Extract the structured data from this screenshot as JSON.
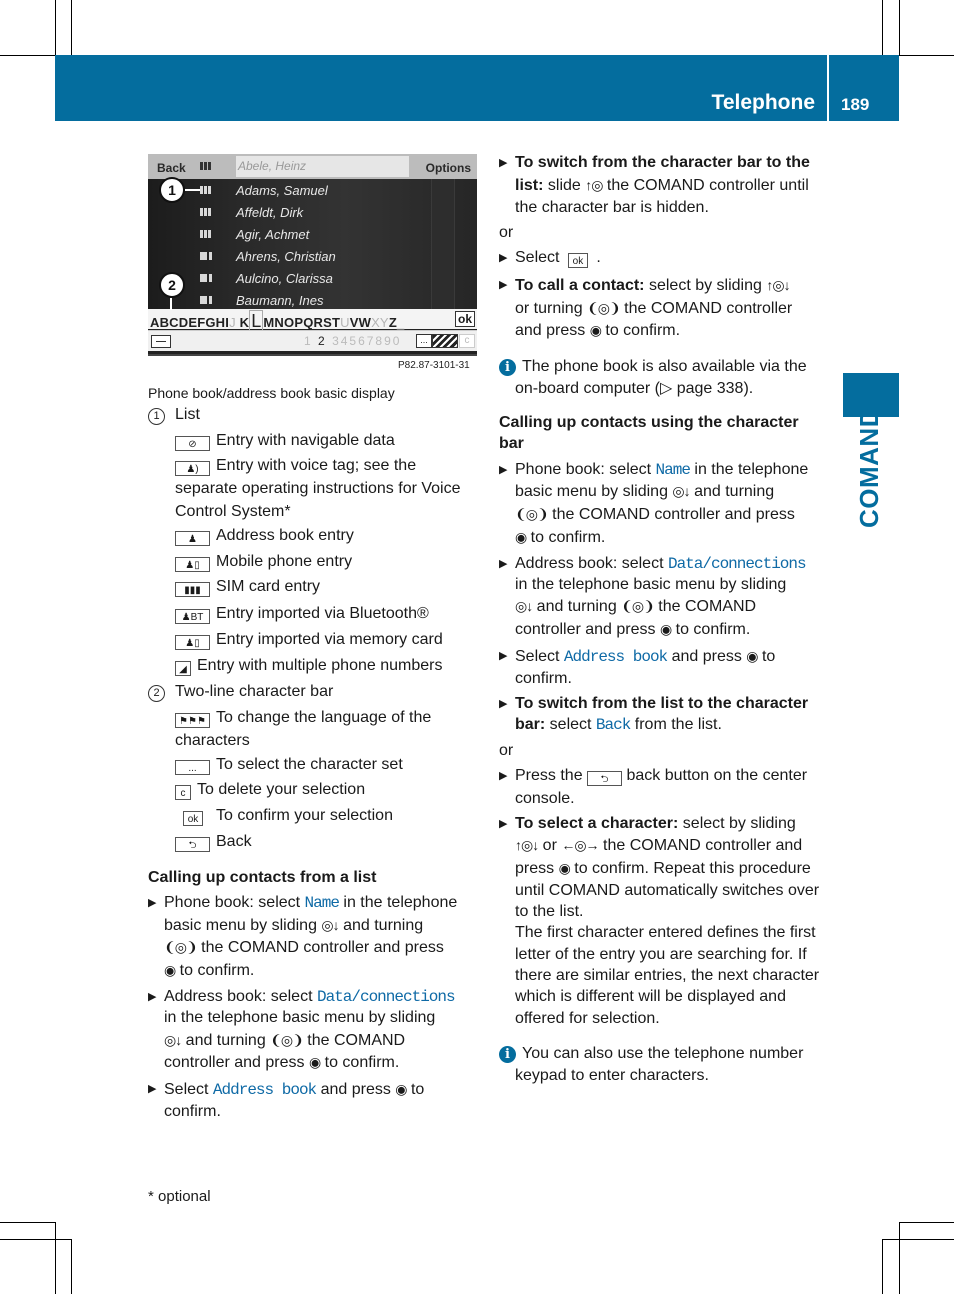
{
  "header": {
    "section_title": "Telephone",
    "page_number": "189",
    "side_label": "COMAND",
    "brand_color": "#046d9e"
  },
  "figure": {
    "back_label": "Back",
    "options_label": "Options",
    "search_value": "Abele, Heinz",
    "contacts": [
      {
        "name": "Adams, Samuel",
        "icon": "sim-card-icon"
      },
      {
        "name": "Affeldt, Dirk",
        "icon": "sim-card-icon"
      },
      {
        "name": "Agir, Achmet",
        "icon": "sim-card-icon"
      },
      {
        "name": "Ahrens, Christian",
        "icon": "mobile-phone-icon"
      },
      {
        "name": "Aulcino, Clarissa",
        "icon": "mobile-phone-icon"
      },
      {
        "name": "Baumann, Ines",
        "icon": "mobile-phone-icon"
      }
    ],
    "chars_pre": "ABCDEFGHI",
    "chars_dim1": "J",
    "chars_k": "K",
    "chars_selected": "L",
    "chars_mid": "MNOPQRST",
    "chars_dim2": "U",
    "chars_vw": "VW",
    "chars_dim3": "XY",
    "chars_z": "Z",
    "chars_dim4": "_",
    "ok_label": "ok",
    "numbers_pre": "1",
    "numbers_current": "2",
    "numbers_post": "34567890",
    "dots_label": "...",
    "c_label": "c",
    "callout_1": "1",
    "callout_2": "2",
    "code": "P82.87-3101-31",
    "caption": "Phone book/address book basic display"
  },
  "legend": {
    "item1_num": "1",
    "item1_label": "List",
    "item1_entries": [
      {
        "icon": "navigation-icon",
        "glyph": "⊘",
        "text": "Entry with navigable data"
      },
      {
        "icon": "voice-tag-icon",
        "glyph": "♟)",
        "text": "Entry with voice tag; see the"
      },
      {
        "icon": "address-book-icon",
        "glyph": "♟",
        "text": "Address book entry"
      },
      {
        "icon": "mobile-phone-icon",
        "glyph": "♟▯",
        "text": "Mobile phone entry"
      },
      {
        "icon": "sim-card-icon",
        "glyph": "▮▮▮",
        "text": "SIM card entry"
      },
      {
        "icon": "bluetooth-import-icon",
        "glyph": "♟BT",
        "text": "Entry imported via Bluetooth®"
      },
      {
        "icon": "memory-card-import-icon",
        "glyph": "♟▯",
        "text": "Entry imported via memory card"
      },
      {
        "icon": "multiple-numbers-icon",
        "glyph": "◢",
        "text": "Entry with multiple phone numbers"
      }
    ],
    "voice_cont1": "separate operating instructions for Voice",
    "voice_cont2": "Control System*",
    "item2_num": "2",
    "item2_label": "Two-line character bar",
    "item2_entries": [
      {
        "icon": "language-flags-icon",
        "glyph": "⚑⚑⚑",
        "text": "To change the language of the"
      },
      {
        "icon": "character-set-icon",
        "glyph": "...",
        "text": "To select the character set"
      },
      {
        "icon": "delete-icon",
        "glyph": "c",
        "text": "To delete your selection"
      },
      {
        "icon": "ok-icon",
        "glyph": "ok",
        "text": "To confirm your selection"
      },
      {
        "icon": "back-icon",
        "glyph": "⮌",
        "text": "Back"
      }
    ],
    "lang_cont": "characters"
  },
  "left_col": {
    "heading": "Calling up contacts from a list",
    "b1": {
      "pre": "Phone book: select ",
      "kw": "Name",
      "post": " in the telephone",
      "l2": "basic menu by sliding ",
      "l2b": " and turning",
      "l3": " the COMAND controller and press",
      "l4": " to confirm."
    },
    "b2": {
      "pre": "Address book: select ",
      "kw": "Data/connections",
      "l2": "in the telephone basic menu by sliding",
      "l3a": " and turning ",
      "l3b": " the COMAND",
      "l4": "controller and press ",
      "l4b": " to confirm."
    },
    "b3": {
      "pre": "Select ",
      "kw": "Address book",
      "post": " and press ",
      "post2": " to",
      "l2": "confirm."
    }
  },
  "right_col": {
    "s1": {
      "bold1": "To switch from the character bar to the",
      "bold2": "list:",
      "t2": " slide ",
      "t2b": " the COMAND controller until",
      "t3": "the character bar is hidden."
    },
    "or1": "or",
    "s2": {
      "pre": "Select ",
      "ok": "ok",
      "post": " ."
    },
    "s3": {
      "bold": "To call a contact:",
      "t1": "  select by sliding ",
      "t2": "or turning ",
      "t2b": " the COMAND controller",
      "t3": "and press ",
      "t3b": " to confirm."
    },
    "info1": {
      "l1": "The phone book is also available via the",
      "l2": "on-board computer (▷ page 338)."
    },
    "heading": "Calling up contacts using the character",
    "heading2": "bar",
    "b1": {
      "pre": "Phone book: select ",
      "kw": "Name",
      "post": " in the telephone",
      "l2": "basic menu by sliding ",
      "l2b": " and turning",
      "l3": " the COMAND controller and press",
      "l4": " to confirm."
    },
    "b2": {
      "pre": "Address book: select ",
      "kw": "Data/connections",
      "l2": "in the telephone basic menu by sliding",
      "l3a": " and turning ",
      "l3b": " the COMAND",
      "l4": "controller and press ",
      "l4b": " to confirm."
    },
    "b3": {
      "pre": "Select ",
      "kw": "Address book",
      "post": " and press ",
      "post2": " to",
      "l2": "confirm."
    },
    "s4": {
      "bold": "To switch from the list to the character",
      "bold2": "bar:",
      "t": " select ",
      "kw": "Back",
      "t2": " from the list."
    },
    "or2": "or",
    "s5": {
      "pre": "Press the ",
      "post": " back button on the center",
      "l2": "console."
    },
    "s6": {
      "bold": "To select a character:",
      "t1": "  select by sliding",
      "l2a": " or ",
      "l2b": " the COMAND controller and",
      "l3a": "press ",
      "l3b": " to confirm. Repeat this procedure",
      "l4": "until COMAND automatically switches over",
      "l5": "to the list."
    },
    "para": [
      "The first character entered defines the first",
      "letter of the entry you are searching for. If",
      "there are similar entries, the next character",
      "which is different will be displayed and",
      "offered for selection."
    ],
    "info2": {
      "l1": "You can also use the telephone number",
      "l2": "keypad to enter characters."
    }
  },
  "controls": {
    "slide_down": "◎↓",
    "slide_up": "↑◎",
    "slide_updown": "↑◎↓",
    "slide_leftright": "←◎→",
    "turn": "❨◎❩",
    "press": "◉"
  },
  "footnote": "* optional"
}
